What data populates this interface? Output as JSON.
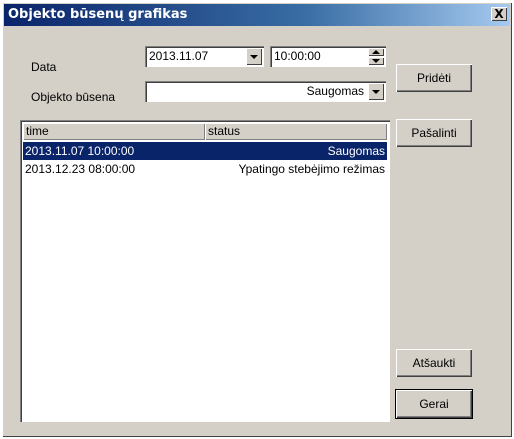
{
  "window": {
    "title": "Objekto būsenų grafikas",
    "close_glyph": "X"
  },
  "form": {
    "date_label": "Data",
    "date_value": "2013.11.07",
    "time_value": "10:00:00",
    "state_label": "Objekto būsena",
    "state_value": "Saugomas"
  },
  "buttons": {
    "add": "Pridėti",
    "remove": "Pašalinti",
    "cancel": "Atšaukti",
    "ok": "Gerai"
  },
  "table": {
    "columns": [
      "time",
      "status"
    ],
    "rows": [
      {
        "time": "2013.11.07 10:00:00",
        "status": "Saugomas",
        "selected": true
      },
      {
        "time": "2013.12.23 08:00:00",
        "status": "Ypatingo stebėjimo režimas",
        "selected": false
      }
    ]
  },
  "colors": {
    "face": "#d4d0c8",
    "title_bar": "#0a246a",
    "selection": "#0a246a"
  }
}
